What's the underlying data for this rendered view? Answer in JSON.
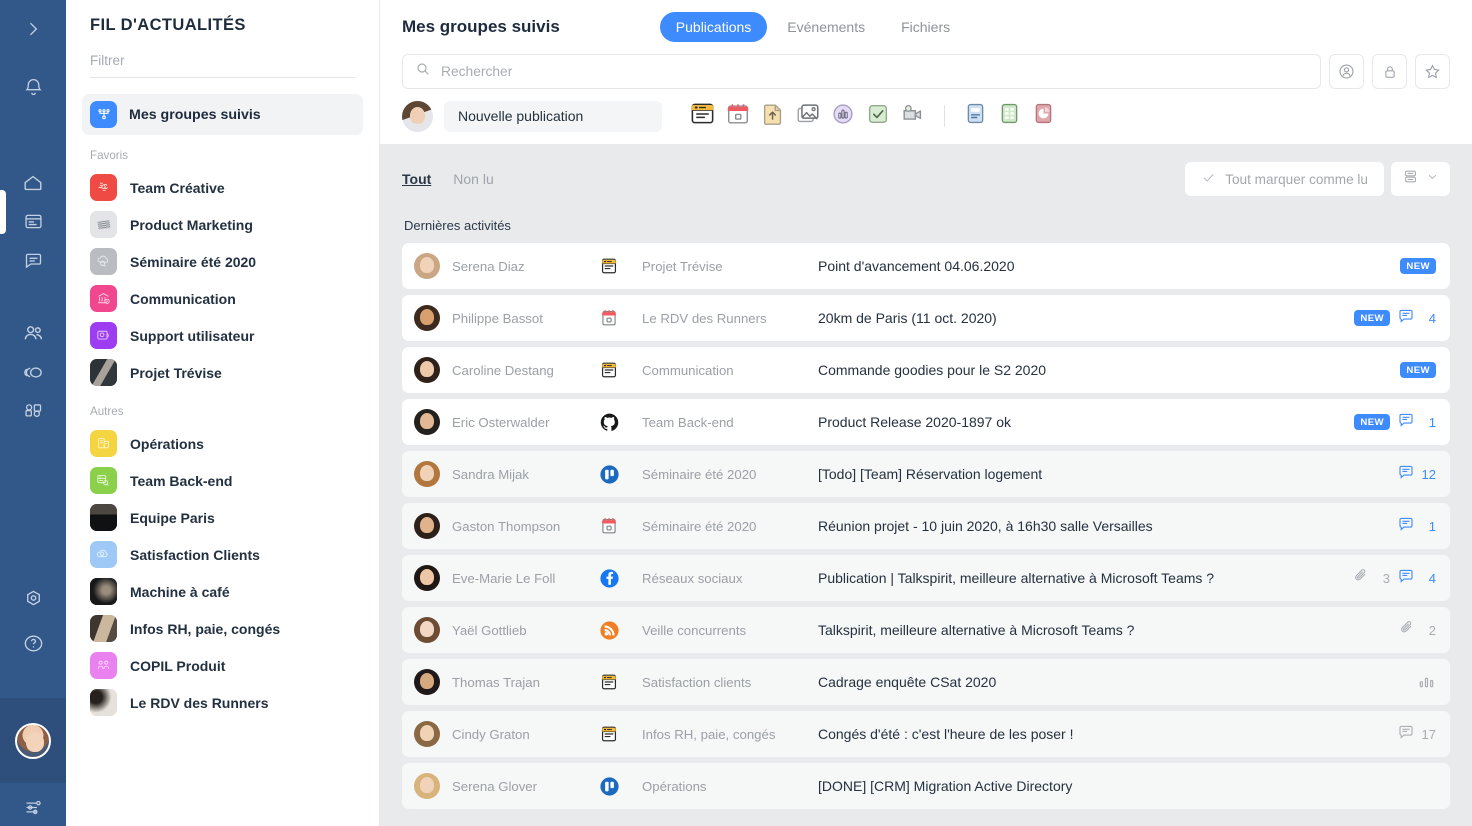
{
  "rail": {
    "icons": [
      {
        "name": "expand-chevron-icon"
      },
      {
        "name": "bell-icon"
      },
      {
        "name": "home-icon"
      },
      {
        "name": "newsfeed-icon"
      },
      {
        "name": "chat-icon"
      },
      {
        "name": "people-icon"
      },
      {
        "name": "groups-icon"
      },
      {
        "name": "apps-icon"
      },
      {
        "name": "settings-icon"
      },
      {
        "name": "help-icon"
      },
      {
        "name": "user-avatar"
      },
      {
        "name": "preferences-sliders-icon"
      }
    ]
  },
  "sidebar": {
    "title": "FIL D'ACTUALITÉS",
    "filter_placeholder": "Filtrer",
    "selected": {
      "label": "Mes groupes suivis",
      "icon": "network-icon"
    },
    "sections": [
      {
        "label": "Favoris",
        "items": [
          {
            "label": "Team Créative",
            "color": "#ef4a43",
            "icon": "mindmap-icon"
          },
          {
            "label": "Product Marketing",
            "color": "#e2e4e7",
            "icon": "photo-icon"
          },
          {
            "label": "Séminaire été 2020",
            "color": "#b9bcc0",
            "icon": "cloud-search-icon"
          },
          {
            "label": "Communication",
            "color": "#f0478e",
            "icon": "bank-icon"
          },
          {
            "label": "Support utilisateur",
            "color": "#9d3cf0",
            "icon": "support-icon"
          },
          {
            "label": "Projet Trévise",
            "color": "#5b6068",
            "icon": "photo-icon"
          }
        ]
      },
      {
        "label": "Autres",
        "items": [
          {
            "label": "Opérations",
            "color": "#f5d442",
            "icon": "ops-icon"
          },
          {
            "label": "Team Back-end",
            "color": "#8ad04a",
            "icon": "server-icon"
          },
          {
            "label": "Equipe Paris",
            "color": "#2b2f33",
            "icon": "photo-icon"
          },
          {
            "label": "Satisfaction Clients",
            "color": "#9ec9f7",
            "icon": "smile-cloud-icon"
          },
          {
            "label": "Machine à café",
            "color": "#1e2124",
            "icon": "photo-icon"
          },
          {
            "label": "Infos RH, paie, congés",
            "color": "#7b6c5d",
            "icon": "photo-icon"
          },
          {
            "label": "COPIL Produit",
            "color": "#e982ef",
            "icon": "team-icon"
          },
          {
            "label": "Le RDV des Runners",
            "color": "#cfc9c2",
            "icon": "photo-icon"
          }
        ]
      }
    ]
  },
  "header": {
    "page_title": "Mes groupes suivis",
    "tabs": [
      {
        "label": "Publications",
        "active": true
      },
      {
        "label": "Evénements",
        "active": false
      },
      {
        "label": "Fichiers",
        "active": false
      }
    ],
    "search_placeholder": "Rechercher",
    "action_buttons": [
      {
        "name": "members-icon"
      },
      {
        "name": "lock-icon"
      },
      {
        "name": "star-icon"
      }
    ]
  },
  "composer": {
    "placeholder": "Nouvelle publication",
    "tools": [
      {
        "name": "article-icon"
      },
      {
        "name": "event-calendar-icon"
      },
      {
        "name": "file-upload-icon"
      },
      {
        "name": "image-icon"
      },
      {
        "name": "poll-icon"
      },
      {
        "name": "task-icon"
      },
      {
        "name": "video-icon"
      }
    ],
    "tools_secondary": [
      {
        "name": "note-icon"
      },
      {
        "name": "spreadsheet-icon"
      },
      {
        "name": "presentation-icon"
      }
    ]
  },
  "feed": {
    "filters": [
      {
        "label": "Tout",
        "active": true
      },
      {
        "label": "Non lu",
        "active": false
      }
    ],
    "mark_all_read": "Tout marquer comme lu",
    "section_title": "Dernières activités",
    "rows": [
      {
        "author": "Serena Diaz",
        "group": "Projet Trévise",
        "group_icon": "article-icon",
        "text": "Point d'avancement 04.06.2020",
        "new": true,
        "comments": null,
        "attachments": null,
        "unread": true,
        "skin": "#f0d3b8",
        "hair": "#caa684"
      },
      {
        "author": "Philippe Bassot",
        "group": "Le RDV des Runners",
        "group_icon": "calendar-icon",
        "text": "20km de Paris (11 oct. 2020)",
        "new": true,
        "comments": 4,
        "attachments": null,
        "unread": true,
        "skin": "#d8a06e",
        "hair": "#3b2a1d"
      },
      {
        "author": "Caroline Destang",
        "group": "Communication",
        "group_icon": "article-icon",
        "text": "Commande goodies pour le S2 2020",
        "new": true,
        "comments": null,
        "attachments": null,
        "unread": true,
        "skin": "#eec8ab",
        "hair": "#2f2119"
      },
      {
        "author": "Eric Osterwalder",
        "group": "Team Back-end",
        "group_icon": "github-icon",
        "text": "Product Release 2020-1897 ok",
        "new": true,
        "comments": 1,
        "attachments": null,
        "unread": true,
        "skin": "#e3b894",
        "hair": "#23201e"
      },
      {
        "author": "Sandra Mijak",
        "group": "Séminaire été 2020",
        "group_icon": "trello-icon",
        "text": "[Todo] [Team] Réservation logement",
        "new": false,
        "comments": 12,
        "attachments": null,
        "unread": false,
        "skin": "#f2d2b6",
        "hair": "#b2763f"
      },
      {
        "author": "Gaston Thompson",
        "group": "Séminaire été 2020",
        "group_icon": "calendar-icon",
        "text": "Réunion projet - 10 juin 2020, à 16h30 salle Versailles",
        "new": false,
        "comments": 1,
        "attachments": null,
        "unread": false,
        "skin": "#e0b38c",
        "hair": "#2c2018"
      },
      {
        "author": "Eve-Marie Le Foll",
        "group": "Réseaux sociaux",
        "group_icon": "facebook-icon",
        "text": "Publication | Talkspirit, meilleure alternative à Microsoft Teams ?",
        "new": false,
        "comments": 4,
        "attachments": 3,
        "unread": false,
        "skin": "#edc6a5",
        "hair": "#1f1714"
      },
      {
        "author": "Yaël Gottlieb",
        "group": "Veille concurrents",
        "group_icon": "rss-icon",
        "text": "Talkspirit, meilleure alternative à Microsoft Teams ?",
        "new": false,
        "comments": null,
        "attachments": 2,
        "unread": false,
        "skin": "#f2d8c4",
        "hair": "#6d4c33"
      },
      {
        "author": "Thomas Trajan",
        "group": "Satisfaction clients",
        "group_icon": "article-icon",
        "text": "Cadrage enquête CSat 2020",
        "new": false,
        "comments": null,
        "attachments": null,
        "poll": true,
        "unread": false,
        "skin": "#d7a97f",
        "hair": "#20191a"
      },
      {
        "author": "Cindy Graton",
        "group": "Infos RH, paie, congés",
        "group_icon": "article-icon",
        "text": "Congés d'été : c'est l'heure de les poser !",
        "new": false,
        "comments": 17,
        "attachments": null,
        "grey_comments": true,
        "unread": false,
        "skin": "#f0d2b4",
        "hair": "#8a6844"
      },
      {
        "author": "Serena Glover",
        "group": "Opérations",
        "group_icon": "trello-icon",
        "text": "[DONE] [CRM] Migration Active Directory",
        "new": false,
        "comments": null,
        "attachments": null,
        "unread": false,
        "skin": "#f1d3b9",
        "hair": "#d8b47c"
      }
    ]
  },
  "colors": {
    "accent": "#3d8bfd",
    "rail": "#325889",
    "feed_bg": "#e9eaeb"
  }
}
